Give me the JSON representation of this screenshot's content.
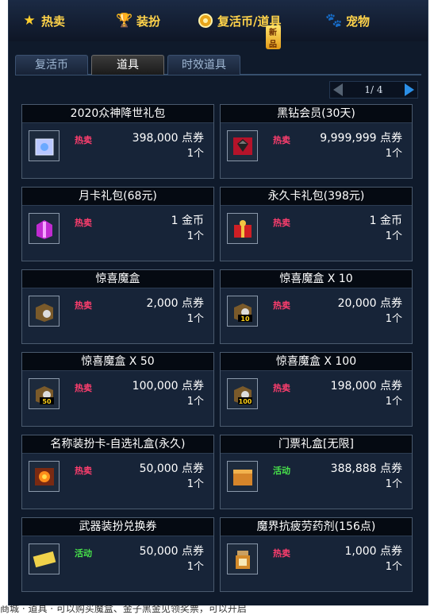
{
  "top_tabs": [
    {
      "label": "热卖",
      "icon": "star-icon"
    },
    {
      "label": "装扮",
      "icon": "trophy-icon"
    },
    {
      "label": "复活币/道具",
      "icon": "coin-icon",
      "badge": "新品"
    },
    {
      "label": "宠物",
      "icon": "paw-icon"
    }
  ],
  "sub_tabs": [
    "复活币",
    "道具",
    "时效道具"
  ],
  "active_sub_tab": "道具",
  "pager": {
    "text": "1/ 4"
  },
  "items": [
    {
      "title": "2020众神降世礼包",
      "badge": "热卖",
      "price": "398,000 点券",
      "qty": "1个",
      "icon": "gift-box-icon"
    },
    {
      "title": "黑钻会员(30天)",
      "badge": "热卖",
      "price": "9,999,999 点券",
      "qty": "1个",
      "icon": "black-diamond-icon"
    },
    {
      "title": "月卡礼包(68元)",
      "badge": "热卖",
      "price": "1 金币",
      "qty": "1个",
      "icon": "purple-gift-icon"
    },
    {
      "title": "永久卡礼包(398元)",
      "badge": "热卖",
      "price": "1 金币",
      "qty": "1个",
      "icon": "red-gift-icon"
    },
    {
      "title": "惊喜魔盒",
      "badge": "热卖",
      "price": "2,000 点券",
      "qty": "1个",
      "icon": "magic-box-icon"
    },
    {
      "title": "惊喜魔盒 X 10",
      "badge": "热卖",
      "price": "20,000 点券",
      "qty": "1个",
      "icon": "magic-box-10-icon"
    },
    {
      "title": "惊喜魔盒 X 50",
      "badge": "热卖",
      "price": "100,000 点券",
      "qty": "1个",
      "icon": "magic-box-50-icon"
    },
    {
      "title": "惊喜魔盒 X 100",
      "badge": "热卖",
      "price": "198,000 点券",
      "qty": "1个",
      "icon": "magic-box-100-icon"
    },
    {
      "title": "名称装扮卡-自选礼盒(永久)",
      "badge": "热卖",
      "price": "50,000 点券",
      "qty": "1个",
      "icon": "flower-card-icon"
    },
    {
      "title": "门票礼盒[无限]",
      "badge": "活动",
      "price": "388,888 点券",
      "qty": "1个",
      "icon": "ticket-box-icon"
    },
    {
      "title": "武器装扮兑换券",
      "badge": "活动",
      "price": "50,000 点券",
      "qty": "1个",
      "icon": "voucher-icon"
    },
    {
      "title": "魔界抗疲劳药剂(156点)",
      "badge": "热卖",
      "price": "1,000 点券",
      "qty": "1个",
      "icon": "potion-icon"
    }
  ],
  "footer_text": "商城 · 道具 · 可以购买魔盒、金子黑金见领奖票，可以开启"
}
